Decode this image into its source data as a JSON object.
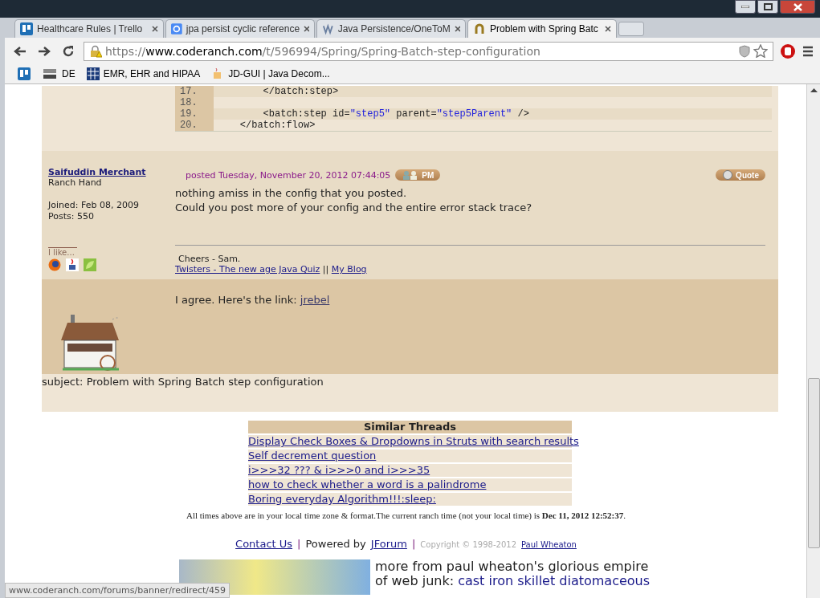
{
  "browser": {
    "tabs": [
      {
        "title": "Healthcare Rules | Trello",
        "selected": false
      },
      {
        "title": "jpa persist cyclic reference",
        "selected": false
      },
      {
        "title": "Java Persistence/OneToM",
        "selected": false
      },
      {
        "title": "Problem with Spring Batc",
        "selected": true
      }
    ],
    "url": {
      "scheme": "https://",
      "host": "www.coderanch.com",
      "path": "/t/596994/Spring/Spring-Batch-step-configuration"
    },
    "bookmarks": [
      "DE",
      "EMR, EHR and HIPAA",
      "JD-GUI | Java Decom..."
    ]
  },
  "code": {
    "lines": [
      {
        "number": "17.",
        "parts": [
          {
            "text": "        </batch:step>",
            "kind": "plain"
          }
        ]
      },
      {
        "number": "18."
      },
      {
        "number": "19.",
        "parts": [
          {
            "text": "        <batch:step id=",
            "kind": "plain"
          },
          {
            "text": "\"step5\"",
            "kind": "string"
          },
          {
            "text": " parent=",
            "kind": "plain"
          },
          {
            "text": "\"step5Parent\"",
            "kind": "string"
          },
          {
            "text": " />",
            "kind": "plain"
          }
        ]
      },
      {
        "number": "20.",
        "parts": [
          {
            "text": "    </batch:flow>",
            "kind": "plain"
          }
        ]
      }
    ]
  },
  "post": {
    "author": "Saifuddin Merchant",
    "rank": "Ranch Hand",
    "joined": "Joined: Feb 08, 2009",
    "posts": "Posts: 550",
    "posted": "posted Tuesday, November 20, 2012 07:44:05",
    "pm_button": "PM",
    "quote_button": "Quote",
    "body": [
      "nothing amiss in the config that you posted.",
      "Could you post more of your config and the entire error stack trace?"
    ],
    "likes_label": "I like...",
    "signature": {
      "text": "Cheers - Sam.",
      "links": [
        "Twisters - The new age Java Quiz",
        "My Blog"
      ],
      "separator": "||"
    }
  },
  "ad_post": {
    "text": "I agree. Here's the link:",
    "link": "jrebel"
  },
  "subject": "subject: Problem with Spring Batch step configuration",
  "similar_threads": {
    "title": "Similar Threads",
    "items": [
      "Display Check Boxes & Dropdowns in Struts with search results",
      "Self decrement question",
      "i>>>32 ??? & i>>>0 and i>>>35",
      "how to check whether a word is a palindrome",
      "Boring everyday Algorithm!!!:sleep:"
    ]
  },
  "time_note": "All times above are in your local time zone & format.The current ranch time (not your local time) is **Dec 11, 2012 12:52:37**.",
  "footer": {
    "contact": "Contact Us",
    "separator_1": "|",
    "powered_by": "Powered by",
    "jforum": "JForum",
    "separator_2": "|",
    "copyright": "Copyright © 1998-2012",
    "owner": "Paul Wheaton"
  },
  "promo": {
    "text": "more from paul wheaton's glorious empire of web junk:",
    "link": "cast iron skillet diatomaceous"
  },
  "status_bubble": "www.coderanch.com/forums/banner/redirect/459"
}
